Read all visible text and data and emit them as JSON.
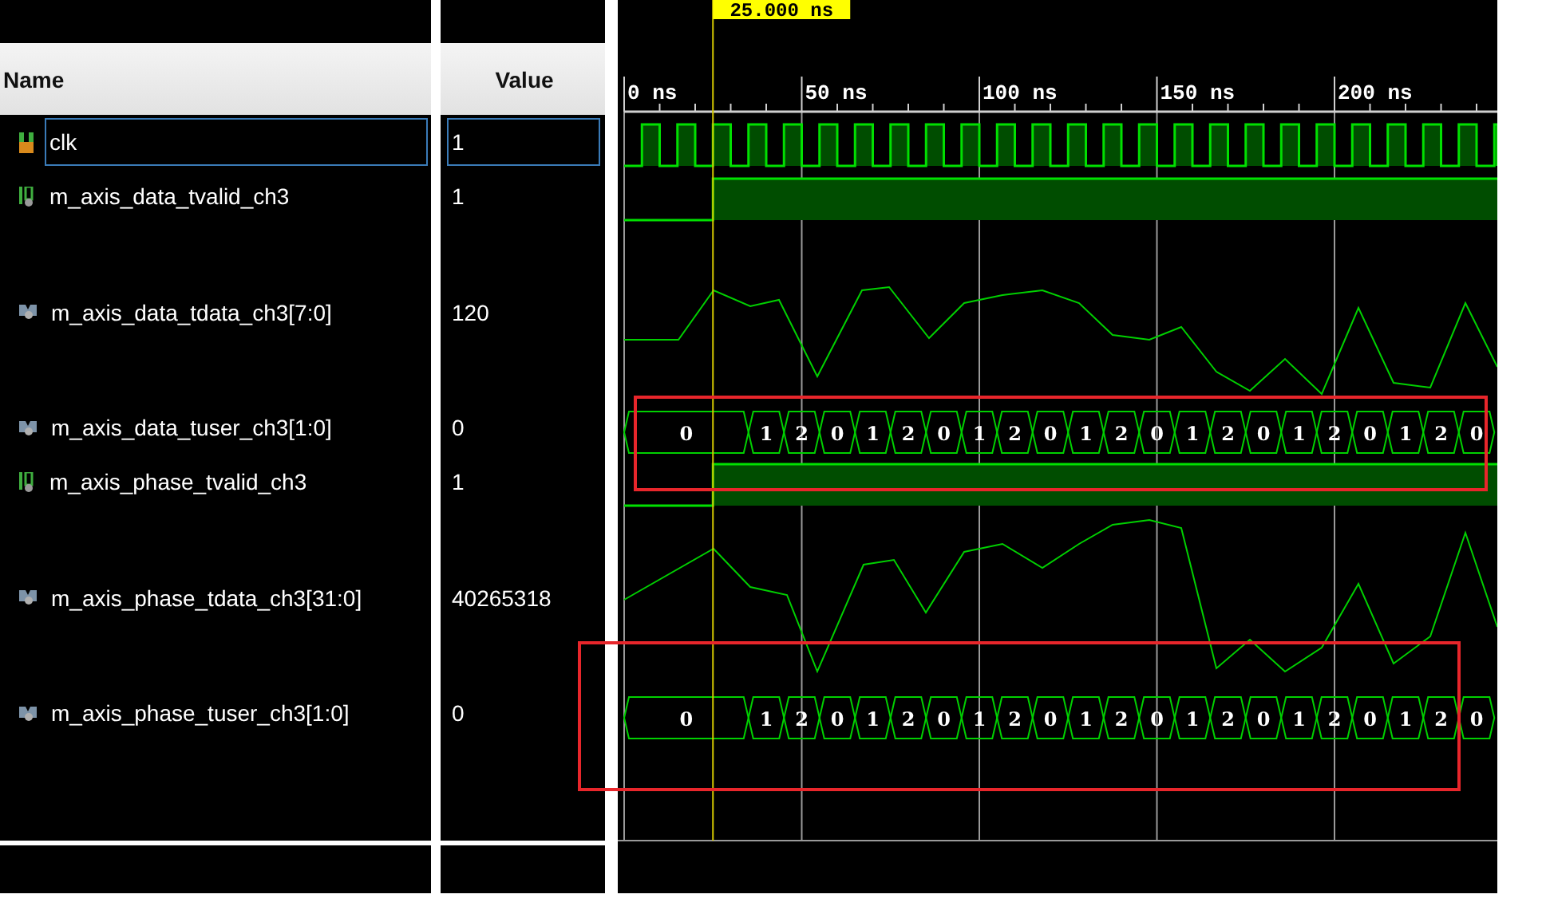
{
  "columns": {
    "name": "Name",
    "value": "Value"
  },
  "cursor": {
    "time_label": "25.000 ns"
  },
  "time_axis": [
    "0 ns",
    "50 ns",
    "100 ns",
    "150 ns",
    "200 ns"
  ],
  "signals": [
    {
      "name": "clk",
      "value": "1",
      "kind": "clock",
      "selected": true
    },
    {
      "name": "m_axis_data_tvalid_ch3",
      "value": "1",
      "kind": "bit",
      "selected": false
    },
    {
      "name": "m_axis_data_tdata_ch3[7:0]",
      "value": "120",
      "kind": "analog",
      "selected": false
    },
    {
      "name": "m_axis_data_tuser_ch3[1:0]",
      "value": "0",
      "kind": "bus",
      "selected": false,
      "segments": [
        "0",
        "1",
        "2",
        "0",
        "1",
        "2",
        "0",
        "1",
        "2",
        "0",
        "1",
        "2",
        "0",
        "1",
        "2",
        "0",
        "1",
        "2",
        "0",
        "1",
        "2",
        "0"
      ]
    },
    {
      "name": "m_axis_phase_tvalid_ch3",
      "value": "1",
      "kind": "bit",
      "selected": false
    },
    {
      "name": "m_axis_phase_tdata_ch3[31:0]",
      "value": "40265318",
      "kind": "analog",
      "selected": false
    },
    {
      "name": "m_axis_phase_tuser_ch3[1:0]",
      "value": "0",
      "kind": "bus",
      "selected": false,
      "segments": [
        "0",
        "1",
        "2",
        "0",
        "1",
        "2",
        "0",
        "1",
        "2",
        "0",
        "1",
        "2",
        "0",
        "1",
        "2",
        "0",
        "1",
        "2",
        "0",
        "1",
        "2",
        "0"
      ]
    }
  ]
}
